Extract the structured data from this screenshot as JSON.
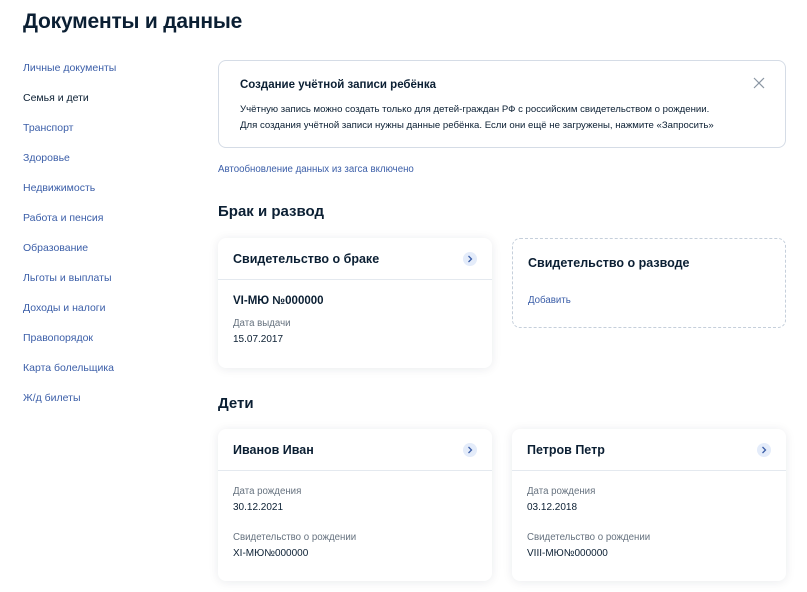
{
  "page": {
    "title": "Документы и данные"
  },
  "sidebar": {
    "items": [
      {
        "label": "Личные документы"
      },
      {
        "label": "Семья и дети"
      },
      {
        "label": "Транспорт"
      },
      {
        "label": "Здоровье"
      },
      {
        "label": "Недвижимость"
      },
      {
        "label": "Работа и пенсия"
      },
      {
        "label": "Образование"
      },
      {
        "label": "Льготы и выплаты"
      },
      {
        "label": "Доходы и налоги"
      },
      {
        "label": "Правопорядок"
      },
      {
        "label": "Карта болельщика"
      },
      {
        "label": "Ж/д билеты"
      }
    ],
    "active_index": 1
  },
  "notice": {
    "title": "Создание учётной записи ребёнка",
    "line1": "Учётную запись можно создать только для детей-граждан РФ с российским свидетельством о рождении.",
    "line2": "Для создания учётной записи нужны данные ребёнка. Если они ещё не загружены, нажмите «Запросить»"
  },
  "autoupdate_link": "Автообновление данных из загса включено",
  "marriage_section": {
    "title": "Брак и развод",
    "marriage_card": {
      "title": "Свидетельство о браке",
      "number": "VI-МЮ №000000",
      "issue_label": "Дата выдачи",
      "issue_date": "15.07.2017"
    },
    "divorce_card": {
      "title": "Свидетельство о разводе",
      "add_label": "Добавить"
    }
  },
  "children_section": {
    "title": "Дети",
    "children": [
      {
        "name": "Иванов Иван",
        "birth_label": "Дата рождения",
        "birth_date": "30.12.2021",
        "cert_label": "Свидетельство о рождении",
        "cert_number": "XI-МЮ№000000"
      },
      {
        "name": "Петров Петр",
        "birth_label": "Дата рождения",
        "birth_date": "03.12.2018",
        "cert_label": "Свидетельство о рождении",
        "cert_number": "VIII-МЮ№000000"
      }
    ]
  },
  "colors": {
    "link": "#3b5ea8",
    "text": "#0b1f33",
    "muted": "#66727f",
    "chevron_bg": "#e4ecfa",
    "border": "#d5dce6"
  }
}
